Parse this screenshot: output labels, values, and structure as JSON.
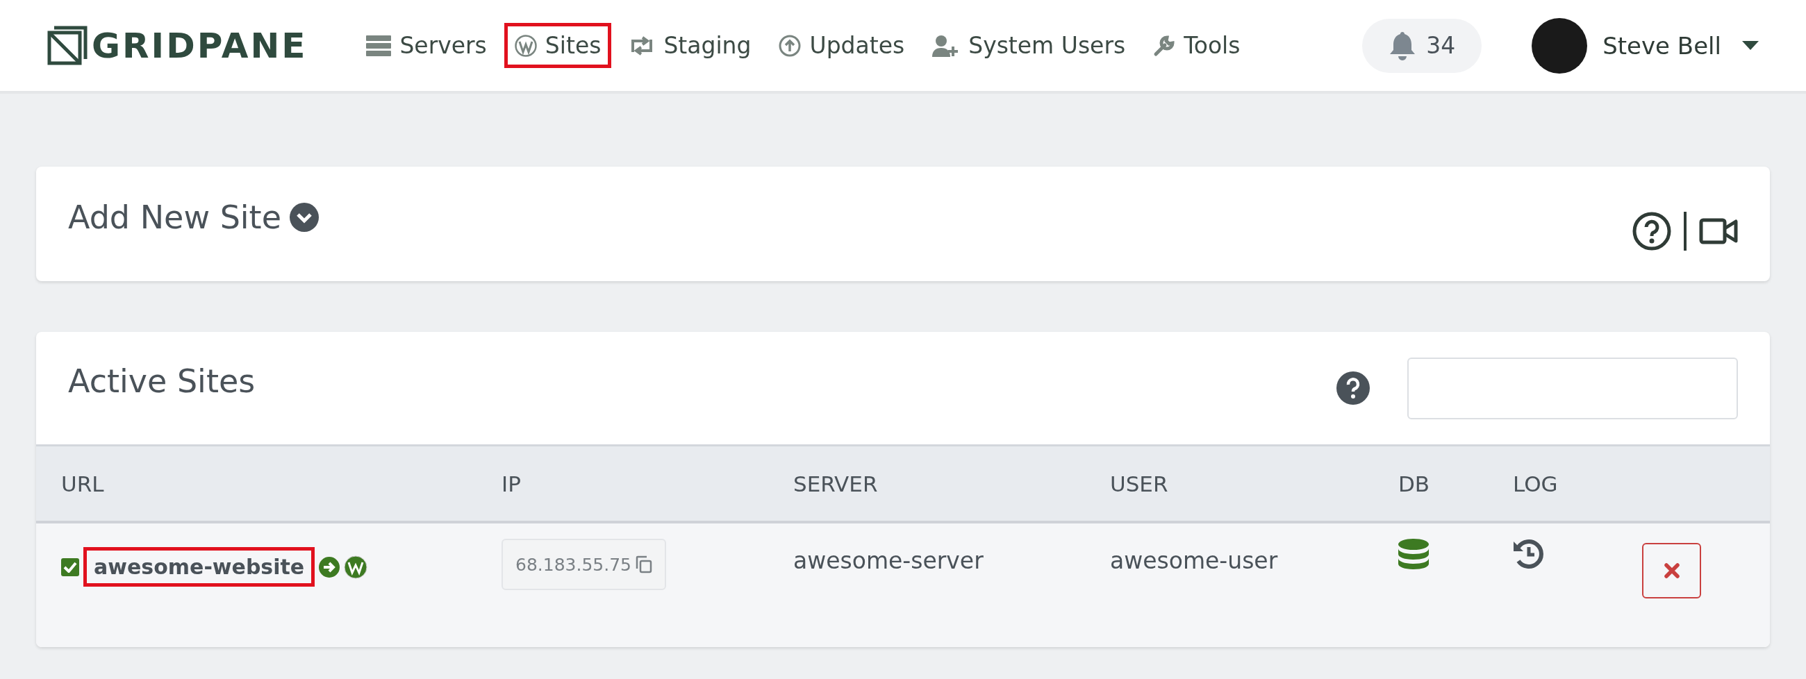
{
  "header": {
    "logo": "GRIDPANE",
    "nav": [
      {
        "label": "Servers",
        "kind": "servers",
        "highlighted": false
      },
      {
        "label": "Sites",
        "kind": "wordpress",
        "highlighted": true
      },
      {
        "label": "Staging",
        "kind": "staging",
        "highlighted": false
      },
      {
        "label": "Updates",
        "kind": "updates",
        "highlighted": false
      },
      {
        "label": "System Users",
        "kind": "users",
        "highlighted": false
      },
      {
        "label": "Tools",
        "kind": "tools",
        "highlighted": false
      }
    ],
    "notifications": "34",
    "user": "Steve Bell"
  },
  "add_site": {
    "title": "Add New Site"
  },
  "active_sites": {
    "title": "Active Sites",
    "table": {
      "columns": [
        "URL",
        "IP",
        "SERVER",
        "USER",
        "DB",
        "LOG"
      ],
      "rows": [
        {
          "checked": true,
          "url": "awesome-website",
          "highlighted": true,
          "ip": "68.183.55.75",
          "server": "awesome-server",
          "user": "awesome-user"
        }
      ]
    }
  }
}
